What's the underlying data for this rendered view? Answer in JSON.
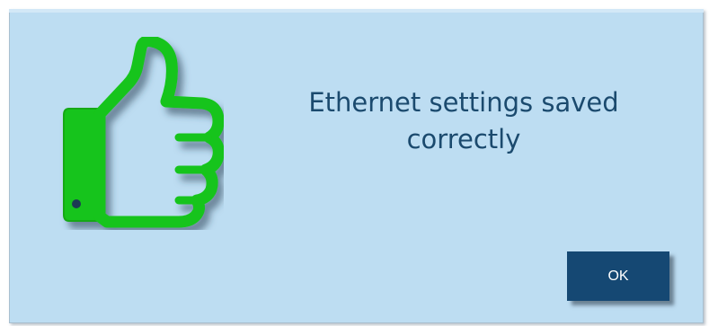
{
  "dialog": {
    "message_line1": "Ethernet settings saved",
    "message_line2": "correctly",
    "icon": "thumbs-up-icon",
    "ok_label": "OK"
  },
  "colors": {
    "dialog_background": "#bdddf2",
    "message_text": "#1b4a6e",
    "icon_green": "#18c41a",
    "button_background": "#154873",
    "button_text": "#ffffff"
  }
}
